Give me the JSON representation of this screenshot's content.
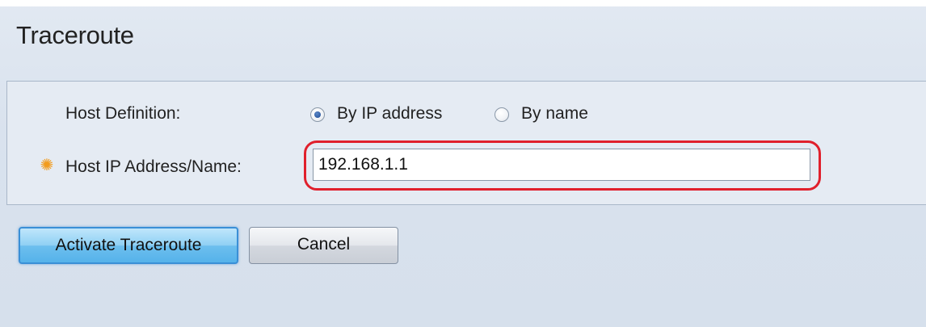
{
  "page": {
    "title": "Traceroute"
  },
  "form": {
    "host_definition_label": "Host Definition:",
    "host_definition_options": [
      {
        "label": "By IP address",
        "checked": true
      },
      {
        "label": "By name",
        "checked": false
      }
    ],
    "host_ip_label": "Host IP Address/Name:",
    "host_ip_value": "192.168.1.1",
    "required_icon": "required-asterisk-icon",
    "highlight_color": "#e0202c"
  },
  "buttons": {
    "activate_label": "Activate Traceroute",
    "cancel_label": "Cancel"
  }
}
